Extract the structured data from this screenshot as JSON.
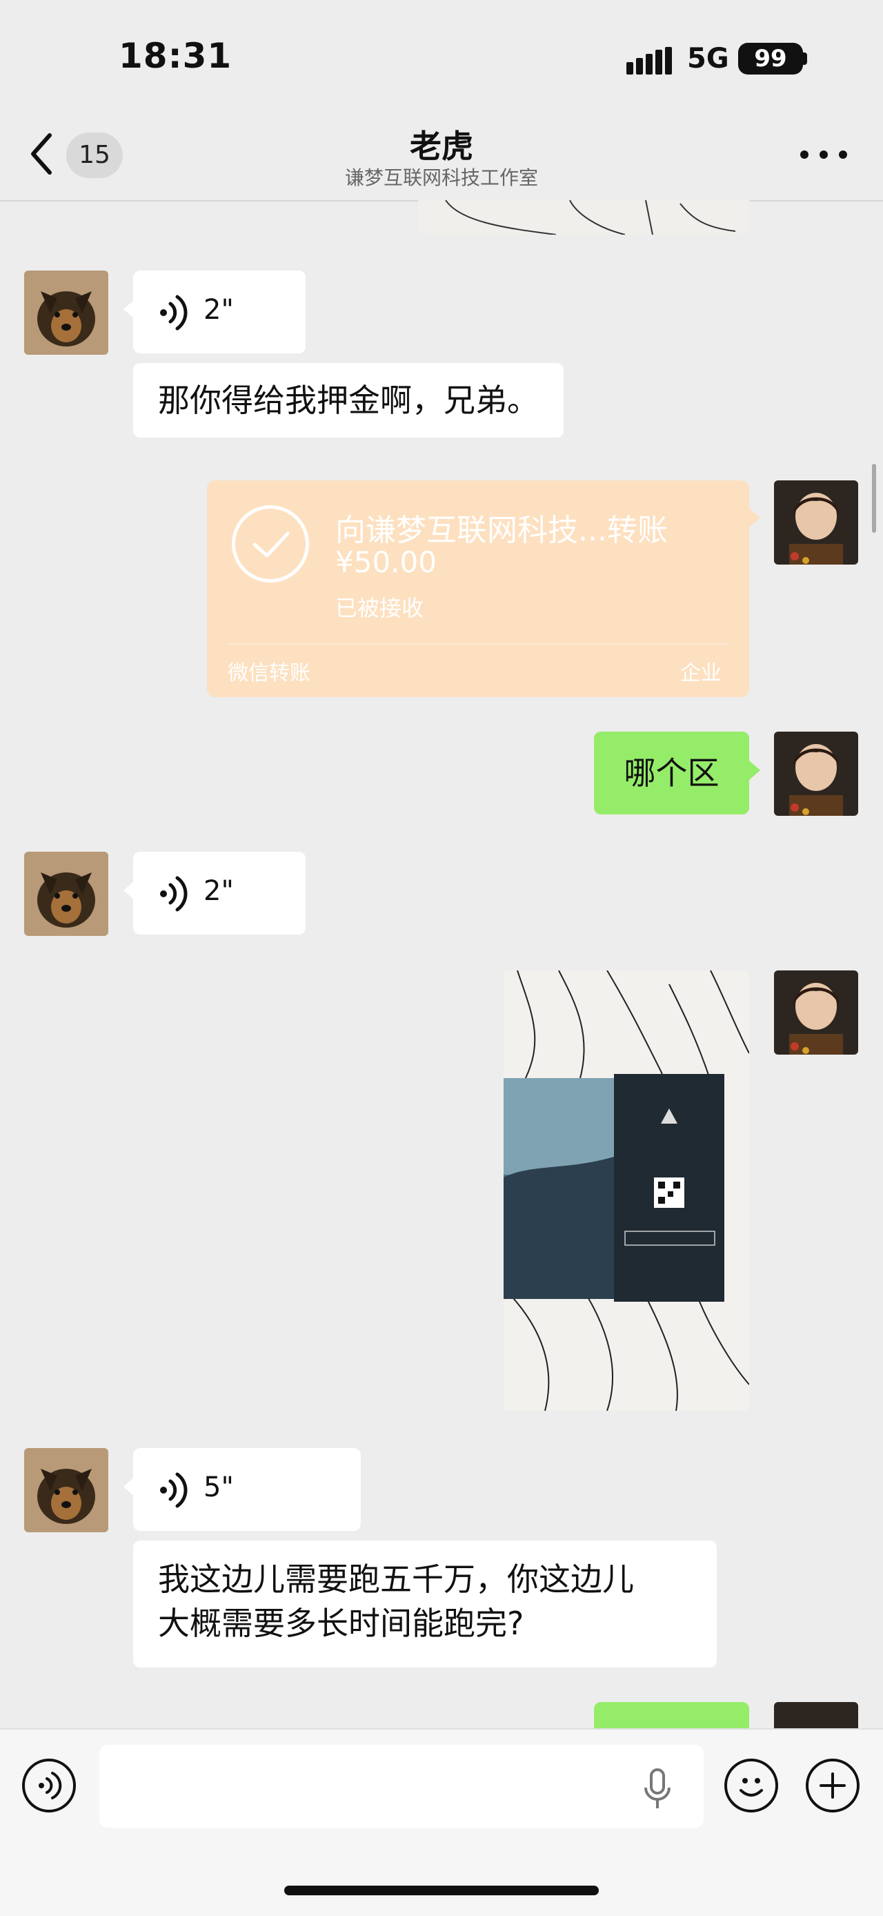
{
  "status_bar": {
    "time": "18:31",
    "network": "5G",
    "battery": "99"
  },
  "nav": {
    "unread_count": "15",
    "title": "老虎",
    "subtitle": "谦梦互联网科技工作室"
  },
  "messages": [
    {
      "type": "voice",
      "side": "left",
      "duration": "2\""
    },
    {
      "type": "text",
      "side": "left",
      "text": "那你得给我押金啊，兄弟。"
    },
    {
      "type": "transfer",
      "side": "right",
      "title": "向谦梦互联网科技...转账",
      "amount": "¥50.00",
      "status": "已被接收",
      "footer_left": "微信转账",
      "footer_right": "企业"
    },
    {
      "type": "text",
      "side": "right",
      "text": "哪个区"
    },
    {
      "type": "voice",
      "side": "left",
      "duration": "2\""
    },
    {
      "type": "image",
      "side": "right"
    },
    {
      "type": "voice",
      "side": "left",
      "duration": "5\""
    },
    {
      "type": "text",
      "side": "left",
      "text_line1": "我这边儿需要跑五千万，你这边儿",
      "text_line2": "大概需要多长时间能跑完?"
    }
  ],
  "colors": {
    "background": "#ededed",
    "my_bubble": "#95ec69",
    "their_bubble": "#ffffff",
    "transfer_card": "#fde0c0"
  }
}
